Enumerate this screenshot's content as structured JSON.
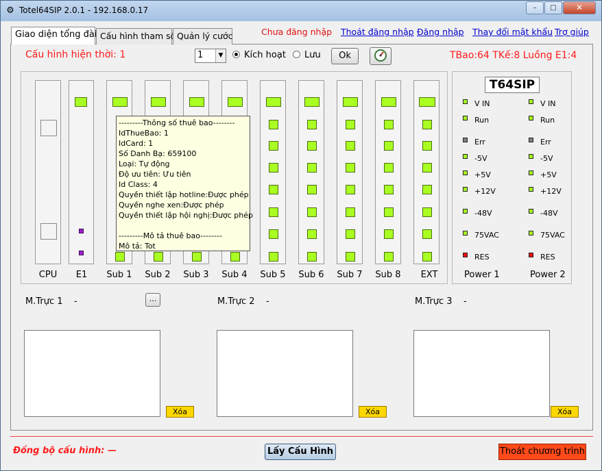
{
  "window": {
    "title": "Totel64SIP 2.0.1 - 192.168.0.17",
    "minimize": "–",
    "maximize": "□",
    "close": "✕"
  },
  "tabs": [
    "Giao diện tổng đài",
    "Cấu hình tham số",
    "Quản lý cước"
  ],
  "top_links": {
    "login_status": "Chưa đăng nhập",
    "logout": "Thoát đăng nhập",
    "login": "Đăng nhập",
    "change_password": "Thay đổi mật khẩu",
    "help": "Trợ giúp"
  },
  "config": {
    "label": "Cấu hình hiện thời: 1",
    "combo_value": "1",
    "radio_activate": "Kích hoạt",
    "radio_save": "Lưu",
    "selected_radio": "Kích hoạt",
    "ok": "Ok"
  },
  "status_right": "TBao:64 TKế:8 Luồng E1:4",
  "slots": [
    "CPU",
    "E1",
    "Sub 1",
    "Sub 2",
    "Sub 3",
    "Sub 4",
    "Sub 5",
    "Sub 6",
    "Sub 7",
    "Sub 8",
    "EXT"
  ],
  "power": {
    "badge": "T64SIP",
    "leds": [
      {
        "label": "V IN",
        "color": "#aaff22"
      },
      {
        "label": "Run",
        "color": "#aaff22"
      },
      {
        "label": "Err",
        "color": "#808080"
      },
      {
        "label": "-5V",
        "color": "#aaff22"
      },
      {
        "label": "+5V",
        "color": "#aaff22"
      },
      {
        "label": "+12V",
        "color": "#aaff22"
      },
      {
        "label": "-48V",
        "color": "#aaff22"
      },
      {
        "label": "75VAC",
        "color": "#aaff22"
      },
      {
        "label": "RES",
        "color": "#ee1111"
      }
    ],
    "leds_p2_labels": [
      "V IN",
      "Run",
      "Err",
      "-5V",
      "+5V",
      "+12V",
      "-48V",
      "75VAC",
      "RES"
    ],
    "power1": "Power 1",
    "power2": "Power 2"
  },
  "tooltip": {
    "lines": [
      "---------Thông số thuê bao--------",
      "IdThueBao: 1",
      "IdCard: 1",
      "Số Danh Bạ: 659100",
      "Loại: Tự động",
      "Độ ưu tiên: Ưu tiên",
      "Id Class: 4",
      "Quyền thiết lập hotline:Được phép",
      "Quyền nghe xen:Được phép",
      "Quyền thiết lập hội nghị:Được phép",
      "",
      "---------Mô tả thuê bao--------",
      "Mô tả: Tot"
    ]
  },
  "operators": [
    {
      "label": "M.Trực 1",
      "value": "-",
      "clear": "Xóa"
    },
    {
      "label": "M.Trực 2",
      "value": "-",
      "clear": "Xóa"
    },
    {
      "label": "M.Trực 3",
      "value": "-",
      "clear": "Xóa"
    }
  ],
  "browse_button": "...",
  "bottom": {
    "sync": "Đồng bộ cấu hình: —",
    "get_config": "Lấy Cấu Hình",
    "exit": "Thoát chương trình"
  }
}
